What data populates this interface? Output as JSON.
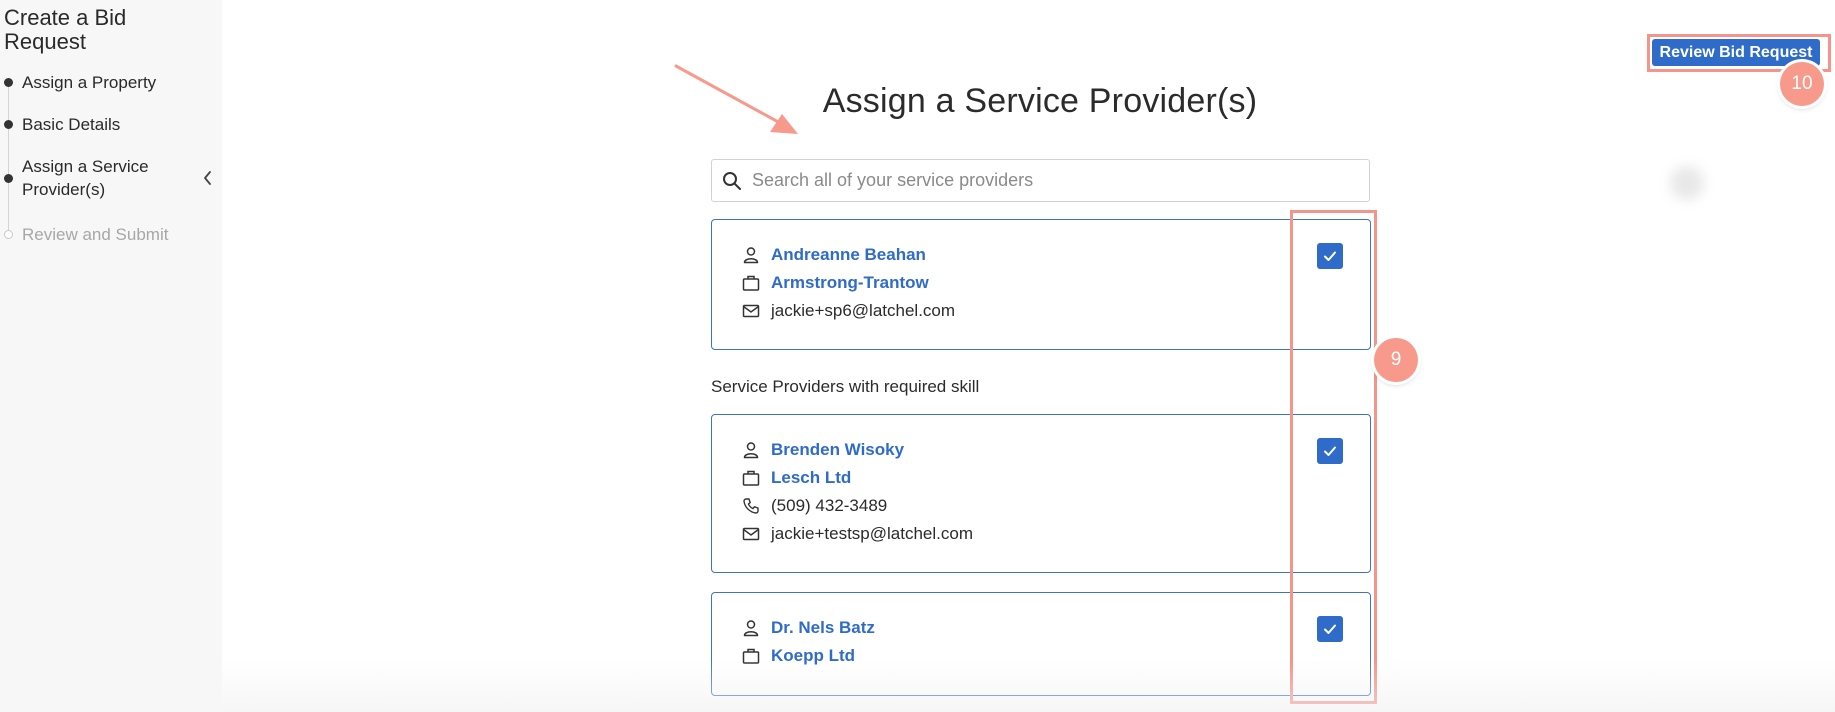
{
  "sidebar": {
    "title": "Create a Bid Request",
    "steps": [
      {
        "label": "Assign a Property",
        "state": "done"
      },
      {
        "label": "Basic Details",
        "state": "done"
      },
      {
        "label": "Assign a Service Provider(s)",
        "state": "current"
      },
      {
        "label": "Review and Submit",
        "state": "pending"
      }
    ]
  },
  "header": {
    "review_button_label": "Review Bid Request"
  },
  "annotations": {
    "badge_checkboxes": "9",
    "badge_review": "10",
    "highlight_color": "#f4948a"
  },
  "main": {
    "title": "Assign a Service Provider(s)",
    "search_placeholder": "Search all of your service providers",
    "section_label": "Service Providers with required skill",
    "providers": [
      {
        "name": "Andreanne Beahan",
        "company": "Armstrong-Trantow",
        "phone": "",
        "email": "jackie+sp6@latchel.com",
        "checked": true
      },
      {
        "name": "Brenden Wisoky",
        "company": "Lesch Ltd",
        "phone": "(509) 432-3489",
        "email": "jackie+testsp@latchel.com",
        "checked": true
      },
      {
        "name": "Dr. Nels Batz",
        "company": "Koepp Ltd",
        "phone": "",
        "email": "",
        "checked": true
      }
    ]
  },
  "colors": {
    "accent": "#2f6bc8",
    "card_border": "#3f72c4"
  }
}
